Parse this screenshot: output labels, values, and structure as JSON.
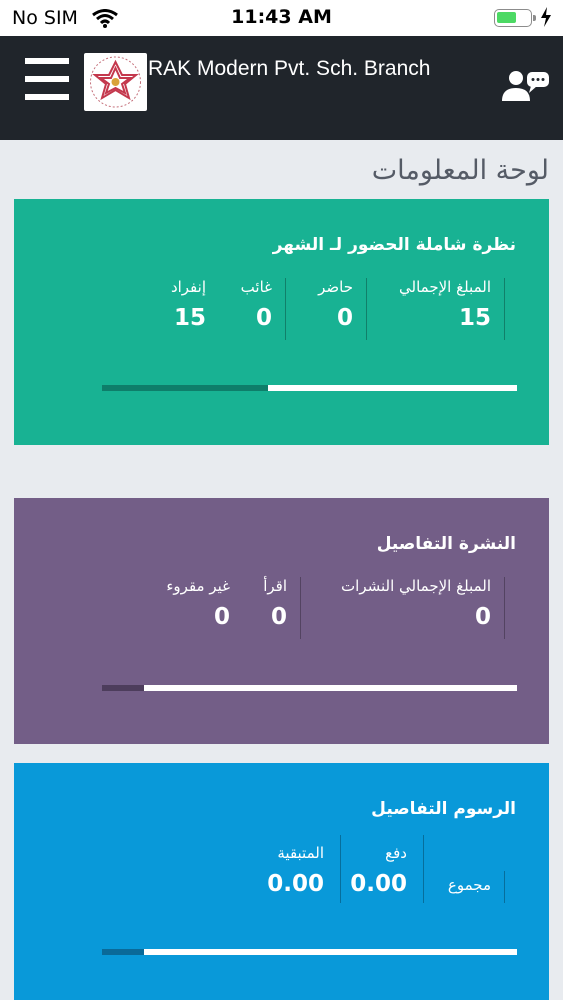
{
  "status_bar": {
    "carrier": "No SIM",
    "time": "11:43 AM"
  },
  "header": {
    "app_title": "RAK Modern Pvt. Sch. Branch",
    "accent": "#20252b"
  },
  "page_title": "لوحة المعلومات",
  "attendance_card": {
    "color": "#18b293",
    "title": "نظرة شاملة الحضور لـ  الشهر",
    "total_label": "المبلغ الإجمالي",
    "total_value": "15",
    "present_label": "حاضر",
    "present_value": "0",
    "absent_label": "غائب",
    "absent_value": "0",
    "leave_label": "إنفراد",
    "leave_value": "15",
    "progress": 0.4
  },
  "newsletter_card": {
    "color": "#735e87",
    "title": "النشرة التفاصيل",
    "total_label": "المبلغ الإجمالي النشرات",
    "total_value": "0",
    "read_label": "اقرأ",
    "read_value": "0",
    "unread_label": "غير مقروء",
    "unread_value": "0",
    "progress": 0.1
  },
  "fees_card": {
    "color": "#0999d9",
    "title": "الرسوم  التفاصيل",
    "total_label": "مجموع",
    "paid_label": "دفع",
    "paid_value": "0.00",
    "remaining_label": "المتبقية",
    "remaining_value": "0.00",
    "progress": 0.1
  }
}
